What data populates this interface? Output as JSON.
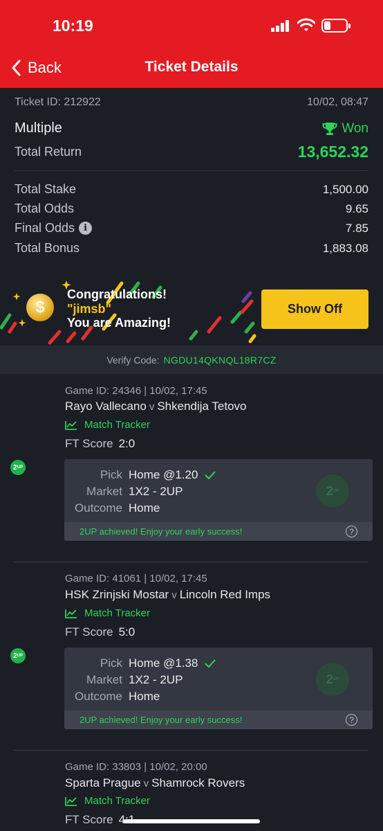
{
  "status": {
    "time": "10:19"
  },
  "nav": {
    "back_label": "Back",
    "title": "Ticket Details"
  },
  "ticket": {
    "id_label": "Ticket ID: 212922",
    "datetime": "10/02, 08:47",
    "type": "Multiple",
    "status": "Won",
    "total_return_label": "Total Return",
    "total_return": "13,652.32",
    "total_stake_label": "Total Stake",
    "total_stake": "1,500.00",
    "total_odds_label": "Total Odds",
    "total_odds": "9.65",
    "final_odds_label": "Final Odds",
    "final_odds": "7.85",
    "total_bonus_label": "Total Bonus",
    "total_bonus": "1,883.08"
  },
  "banner": {
    "line1": "Congratulations!",
    "username": "\"jimsb\"",
    "line3": "You are Amazing!",
    "button": "Show Off"
  },
  "verify": {
    "label": "Verify Code:",
    "code": "NGDU14QKNQL18R7CZ"
  },
  "games": [
    {
      "meta": "Game ID: 24346 | 10/02, 17:45",
      "home": "Rayo Vallecano",
      "v": "v",
      "away": "Shkendija Tetovo",
      "tracker": "Match Tracker",
      "score_label": "FT Score",
      "score": "2:0",
      "pick_label": "Pick",
      "pick": "Home @1.20",
      "market_label": "Market",
      "market": "1X2 - 2UP",
      "outcome_label": "Outcome",
      "outcome": "Home",
      "footer": "2UP achieved! Enjoy your early success!"
    },
    {
      "meta": "Game ID: 41061 | 10/02, 17:45",
      "home": "HSK Zrinjski Mostar",
      "v": "v",
      "away": "Lincoln Red Imps",
      "tracker": "Match Tracker",
      "score_label": "FT Score",
      "score": "5:0",
      "pick_label": "Pick",
      "pick": "Home @1.38",
      "market_label": "Market",
      "market": "1X2 - 2UP",
      "outcome_label": "Outcome",
      "outcome": "Home",
      "footer": "2UP achieved! Enjoy your early success!"
    },
    {
      "meta": "Game ID: 33803 | 10/02, 20:00",
      "home": "Sparta Prague",
      "v": "v",
      "away": "Shamrock Rovers",
      "tracker": "Match Tracker",
      "score_label": "FT Score",
      "score": "4:1"
    }
  ],
  "colors": {
    "brand_red": "#e41b23",
    "win_green": "#2fd35a",
    "button_yellow": "#f6c31a",
    "background": "#1b1e25"
  }
}
